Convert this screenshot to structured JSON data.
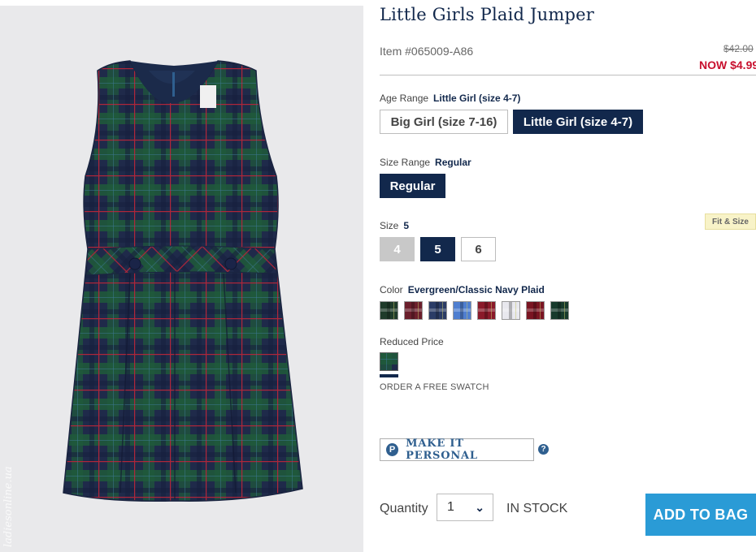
{
  "product": {
    "title": "Little Girls Plaid Jumper",
    "item_number": "Item #065009-A86",
    "price_original": "$42.00",
    "price_now": "NOW $4.99"
  },
  "image": {
    "watermark": "ladiesonline.ua"
  },
  "age_range": {
    "label": "Age Range",
    "selected": "Little Girl (size 4-7)",
    "options": [
      "Big Girl (size 7-16)",
      "Little Girl (size 4-7)"
    ]
  },
  "size_range": {
    "label": "Size Range",
    "selected": "Regular",
    "options": [
      "Regular"
    ]
  },
  "size": {
    "label": "Size",
    "selected": "5",
    "options": [
      "4",
      "5",
      "6"
    ],
    "fit_link": "Fit & Size"
  },
  "color": {
    "label": "Color",
    "selected": "Evergreen/Classic Navy Plaid",
    "swatch_colors": [
      "#1f3b2a",
      "#6b1f2c",
      "#2b3c66",
      "#4f7fd0",
      "#8a1a2a",
      "#e8e8ee",
      "#7a1522",
      "#173a2c"
    ]
  },
  "reduced": {
    "label": "Reduced Price",
    "free_swatch": "ORDER A FREE SWATCH"
  },
  "personalize": {
    "icon_letter": "P",
    "label": "MAKE IT PERSONAL",
    "help": "?"
  },
  "purchase": {
    "quantity_label": "Quantity",
    "quantity_value": "1",
    "stock": "IN STOCK",
    "add_to_bag": "ADD TO BAG"
  },
  "colors": {
    "navy": "#12284c",
    "sale_red": "#c8102e",
    "cta_blue": "#2a9bd6"
  }
}
